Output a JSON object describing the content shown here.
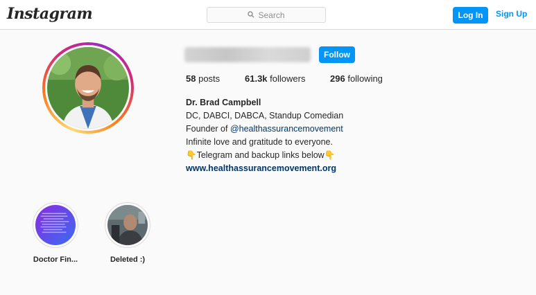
{
  "header": {
    "logo": "Instagram",
    "search_placeholder": "Search",
    "login_label": "Log In",
    "signup_label": "Sign Up"
  },
  "profile": {
    "follow_label": "Follow",
    "stats": {
      "posts_count": "58",
      "posts_label": "posts",
      "followers_count": "61.3k",
      "followers_label": "followers",
      "following_count": "296",
      "following_label": "following"
    },
    "bio": {
      "name": "Dr. Brad Campbell",
      "line1": "DC, DABCI, DABCA, Standup Comedian",
      "line2_prefix": "Founder of ",
      "line2_mention": "@healthassurancemovement",
      "line3": "Infinite love and gratitude to everyone.",
      "line4_emoji_left": "👇",
      "line4_text": "Telegram and backup links below",
      "line4_emoji_right": "👇",
      "website": "www.healthassurancemovement.org"
    }
  },
  "highlights": [
    {
      "label": "Doctor Fin..."
    },
    {
      "label": "Deleted :)"
    }
  ],
  "colors": {
    "accent": "#0095f6",
    "link": "#00376b",
    "background": "#fafafa",
    "border": "#dbdbdb"
  }
}
